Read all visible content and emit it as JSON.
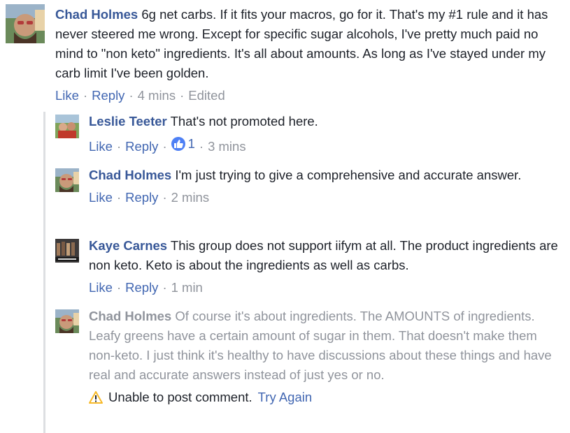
{
  "main_comment": {
    "author": "Chad Holmes",
    "text": "6g net carbs. If it fits your macros, go for it. That's my #1 rule and it has never steered me wrong. Except for specific sugar alcohols, I've pretty much paid no mind to \"non keto\" ingredients. It's all about amounts. As long as I've stayed under my carb limit I've been golden.",
    "like_label": "Like",
    "reply_label": "Reply",
    "time": "4 mins",
    "edited": "Edited"
  },
  "replies": [
    {
      "author": "Leslie Teeter",
      "text": "That's not promoted here.",
      "like_label": "Like",
      "reply_label": "Reply",
      "reaction_count": "1",
      "time": "3 mins"
    },
    {
      "author": "Chad Holmes",
      "text": "I'm just trying to give a comprehensive and accurate answer.",
      "like_label": "Like",
      "reply_label": "Reply",
      "time": "2 mins"
    },
    {
      "author": "Kaye Carnes",
      "text": "This group does not support iifym at all. The product ingredients are non keto. Keto is about the ingredients as well as carbs.",
      "like_label": "Like",
      "reply_label": "Reply",
      "time": "1 min"
    },
    {
      "author": "Chad Holmes",
      "text": "Of course it's about ingredients. The AMOUNTS of ingredients. Leafy greens have a certain amount of sugar in them. That doesn't make them non-keto. I just think it's healthy to have discussions about these things and have real and accurate answers instead of just yes or no.",
      "error_text": "Unable to post comment.",
      "retry_label": "Try Again"
    }
  ],
  "separator": "·",
  "colors": {
    "link": "#385898",
    "action": "#4267b2",
    "meta": "#90949c",
    "like_reaction": "#4e80f5",
    "warning": "#f7b928"
  }
}
